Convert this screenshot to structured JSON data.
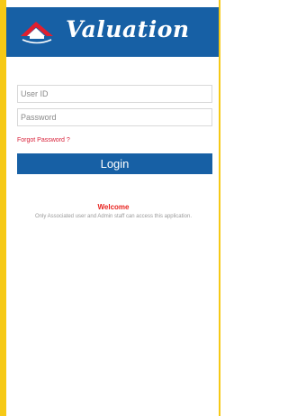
{
  "header": {
    "title": "Valuation",
    "logo_icon": "house-roof-logo-icon",
    "background_color": "#1760a5"
  },
  "login_form": {
    "user_id_placeholder": "User ID",
    "password_placeholder": "Password",
    "forgot_password_label": "Forgot Password ?",
    "login_button_label": "Login"
  },
  "footer": {
    "welcome_title": "Welcome",
    "notice_text": "Only Associated user and Admin staff can access this application."
  },
  "colors": {
    "accent": "#1760a5",
    "frame": "#f6c916",
    "link": "#d9233b",
    "welcome": "#e8231f"
  }
}
